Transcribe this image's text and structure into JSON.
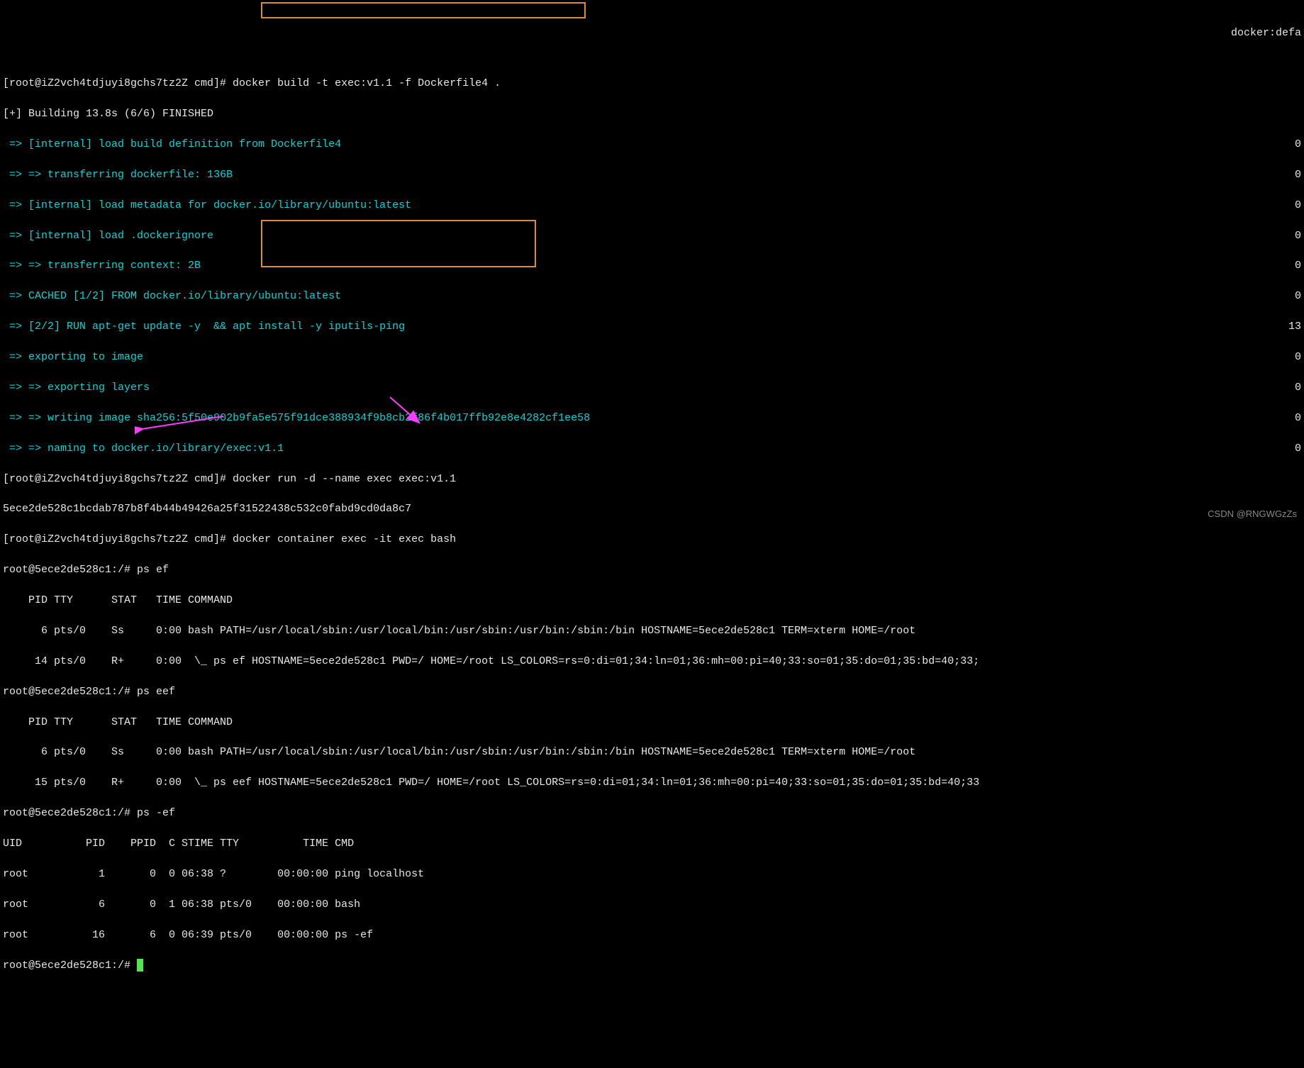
{
  "lines": {
    "l0": "[root@iZ2vch4tdjuyi8gchs7tz2Z cmd]# docker build -t exec:v1.1 -f Dockerfile4 .",
    "l1": "[+] Building 13.8s (6/6) FINISHED",
    "l1r": "docker:defa",
    "l2": "=> [internal] load build definition from Dockerfile4",
    "l3": "=> => transferring dockerfile: 136B",
    "l4": "=> [internal] load metadata for docker.io/library/ubuntu:latest",
    "l5": "=> [internal] load .dockerignore",
    "l6": "=> => transferring context: 2B",
    "l7": "=> CACHED [1/2] FROM docker.io/library/ubuntu:latest",
    "l8": "=> [2/2] RUN apt-get update -y  && apt install -y iputils-ping",
    "l9": "=> exporting to image",
    "l10": "=> => exporting layers",
    "l11": "=> => writing image sha256:5f50e902b9fa5e575f91dce388934f9b8cb2f86f4b017ffb92e8e4282cf1ee58",
    "l12": "=> => naming to docker.io/library/exec:v1.1",
    "l13": "[root@iZ2vch4tdjuyi8gchs7tz2Z cmd]# docker run -d --name exec exec:v1.1",
    "l14": "5ece2de528c1bcdab787b8f4b44b49426a25f31522438c532c0fabd9cd0da8c7",
    "l15": "[root@iZ2vch4tdjuyi8gchs7tz2Z cmd]# docker container exec -it exec bash",
    "l16": "root@5ece2de528c1:/# ps ef",
    "l17": "    PID TTY      STAT   TIME COMMAND",
    "l18": "      6 pts/0    Ss     0:00 bash PATH=/usr/local/sbin:/usr/local/bin:/usr/sbin:/usr/bin:/sbin:/bin HOSTNAME=5ece2de528c1 TERM=xterm HOME=/root",
    "l19": "     14 pts/0    R+     0:00  \\_ ps ef HOSTNAME=5ece2de528c1 PWD=/ HOME=/root LS_COLORS=rs=0:di=01;34:ln=01;36:mh=00:pi=40;33:so=01;35:do=01;35:bd=40;33;",
    "l20": "root@5ece2de528c1:/# ps eef",
    "l21": "    PID TTY      STAT   TIME COMMAND",
    "l22": "      6 pts/0    Ss     0:00 bash PATH=/usr/local/sbin:/usr/local/bin:/usr/sbin:/usr/bin:/sbin:/bin HOSTNAME=5ece2de528c1 TERM=xterm HOME=/root",
    "l23": "     15 pts/0    R+     0:00  \\_ ps eef HOSTNAME=5ece2de528c1 PWD=/ HOME=/root LS_COLORS=rs=0:di=01;34:ln=01;36:mh=00:pi=40;33:so=01;35:do=01;35:bd=40;33",
    "l24": "root@5ece2de528c1:/# ps -ef",
    "l25": "UID          PID    PPID  C STIME TTY          TIME CMD",
    "l26": "root           1       0  0 06:38 ?        00:00:00 ping localhost",
    "l27": "root           6       0  1 06:38 pts/0    00:00:00 bash",
    "l28": "root          16       6  0 06:39 pts/0    00:00:00 ps -ef",
    "l29": "root@5ece2de528c1:/# "
  },
  "right_nums": {
    "r2": "0",
    "r3": "0",
    "r4": "0",
    "r5": "0",
    "r6": "0",
    "r7": "0",
    "r8": "13",
    "r9": "0",
    "r10": "0",
    "r11": "0",
    "r12": "0"
  },
  "watermark": "CSDN @RNGWGzZs"
}
